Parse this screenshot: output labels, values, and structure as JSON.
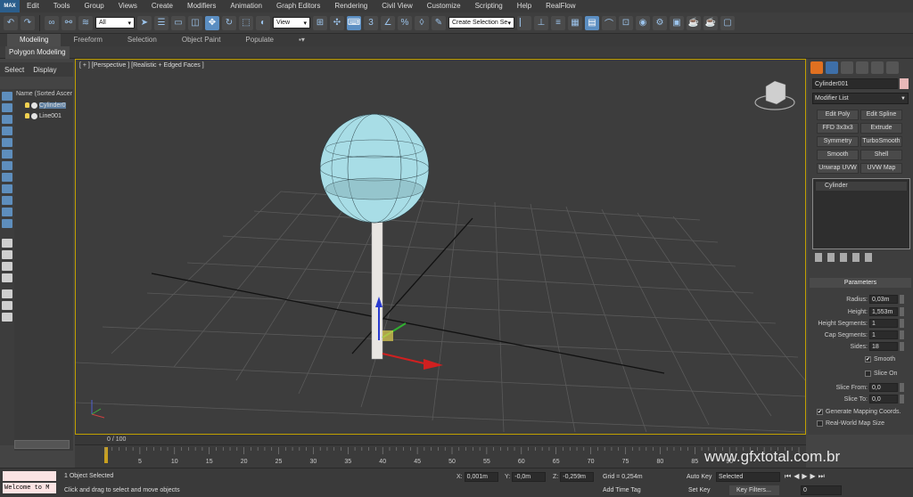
{
  "app": {
    "logo": "MAX"
  },
  "menu": [
    "Edit",
    "Tools",
    "Group",
    "Views",
    "Create",
    "Modifiers",
    "Animation",
    "Graph Editors",
    "Rendering",
    "Civil View",
    "Customize",
    "Scripting",
    "Help",
    "RealFlow"
  ],
  "toolbar": {
    "filter": "All",
    "ref_coord": "View",
    "named_selection": "Create Selection Se"
  },
  "ribbon": {
    "tabs": [
      "Modeling",
      "Freeform",
      "Selection",
      "Object Paint",
      "Populate"
    ],
    "active_tab": "Modeling",
    "panel": "Polygon Modeling"
  },
  "scene": {
    "tabs": [
      "Select",
      "Display"
    ],
    "header": "Name (Sorted Ascer",
    "items": [
      {
        "label": "Cylinder0"
      },
      {
        "label": "Line001"
      }
    ]
  },
  "viewport": {
    "label": "[ + ] [Perspective ] [Realistic + Edged Faces ]"
  },
  "command_panel": {
    "object_name": "Cylinder001",
    "object_color": "#e8b8b8",
    "modifier_list": "Modifier List",
    "modifier_buttons": [
      "Edit Poly",
      "Edit Spline",
      "FFD 3x3x3",
      "Extrude",
      "Symmetry",
      "TurboSmooth",
      "Smooth",
      "Shell",
      "Unwrap UVW",
      "UVW Map"
    ],
    "stack": [
      "Cylinder"
    ],
    "parameters": {
      "title": "Parameters",
      "radius_label": "Radius:",
      "radius": "0,03m",
      "height_label": "Height:",
      "height": "1,553m",
      "height_segments_label": "Height Segments:",
      "height_segments": "1",
      "cap_segments_label": "Cap Segments:",
      "cap_segments": "1",
      "sides_label": "Sides:",
      "sides": "18",
      "smooth_label": "Smooth",
      "slice_on_label": "Slice On",
      "slice_from_label": "Slice From:",
      "slice_from": "0,0",
      "slice_to_label": "Slice To:",
      "slice_to": "0,0",
      "gen_mapping_label": "Generate Mapping Coords.",
      "real_world_label": "Real-World Map Size"
    }
  },
  "timeline": {
    "position": "0 / 100",
    "ticks": [
      "5",
      "10",
      "15",
      "20",
      "25",
      "30",
      "35",
      "40",
      "45",
      "50",
      "55",
      "60",
      "65",
      "70",
      "75",
      "80",
      "85",
      "90"
    ]
  },
  "status": {
    "welcome": "Welcome to M",
    "message": "1 Object Selected",
    "prompt": "Click and drag to select and move objects",
    "x_label": "X:",
    "x": "0,001m",
    "y_label": "Y:",
    "y": "-0,0m",
    "z_label": "Z:",
    "z": "-0,259m",
    "grid": "Grid = 0,254m",
    "add_time_tag": "Add Time Tag",
    "auto_key": "Auto Key",
    "set_key": "Set Key",
    "selected": "Selected",
    "key_filters": "Key Filters...",
    "frame": "0"
  },
  "watermark": "www.gfxtotal.com.br"
}
